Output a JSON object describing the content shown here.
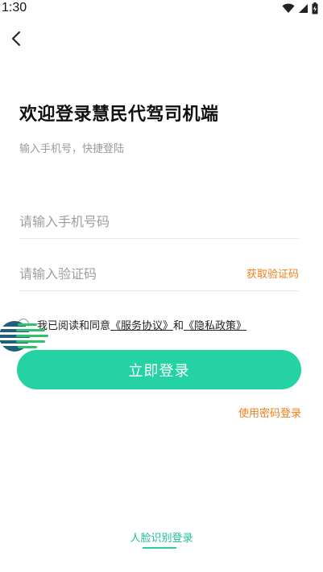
{
  "status_bar": {
    "time": "1:30",
    "icons": [
      "wifi-icon",
      "cellular-signal-icon",
      "battery-charging-icon"
    ]
  },
  "header": {
    "back_icon": "chevron-left-icon",
    "title": "欢迎登录慧民代驾司机端",
    "subtitle": "输入手机号，快捷登陆"
  },
  "form": {
    "phone_placeholder": "请输入手机号码",
    "phone_value": "",
    "code_placeholder": "请输入验证码",
    "code_value": "",
    "get_code_label": "获取验证码"
  },
  "agreement": {
    "checked": false,
    "prefix": "我已阅读和同意",
    "service_link": "《服务协议》",
    "joiner": "和",
    "privacy_link": "《隐私政策》"
  },
  "actions": {
    "login_label": "立即登录",
    "password_login_label": "使用密码登录",
    "face_login_label": "人脸识别登录"
  },
  "colors": {
    "primary": "#24d2a3",
    "accent_orange": "#f07d1a",
    "placeholder": "#9e9e9e",
    "divider": "#e8e8e8"
  }
}
